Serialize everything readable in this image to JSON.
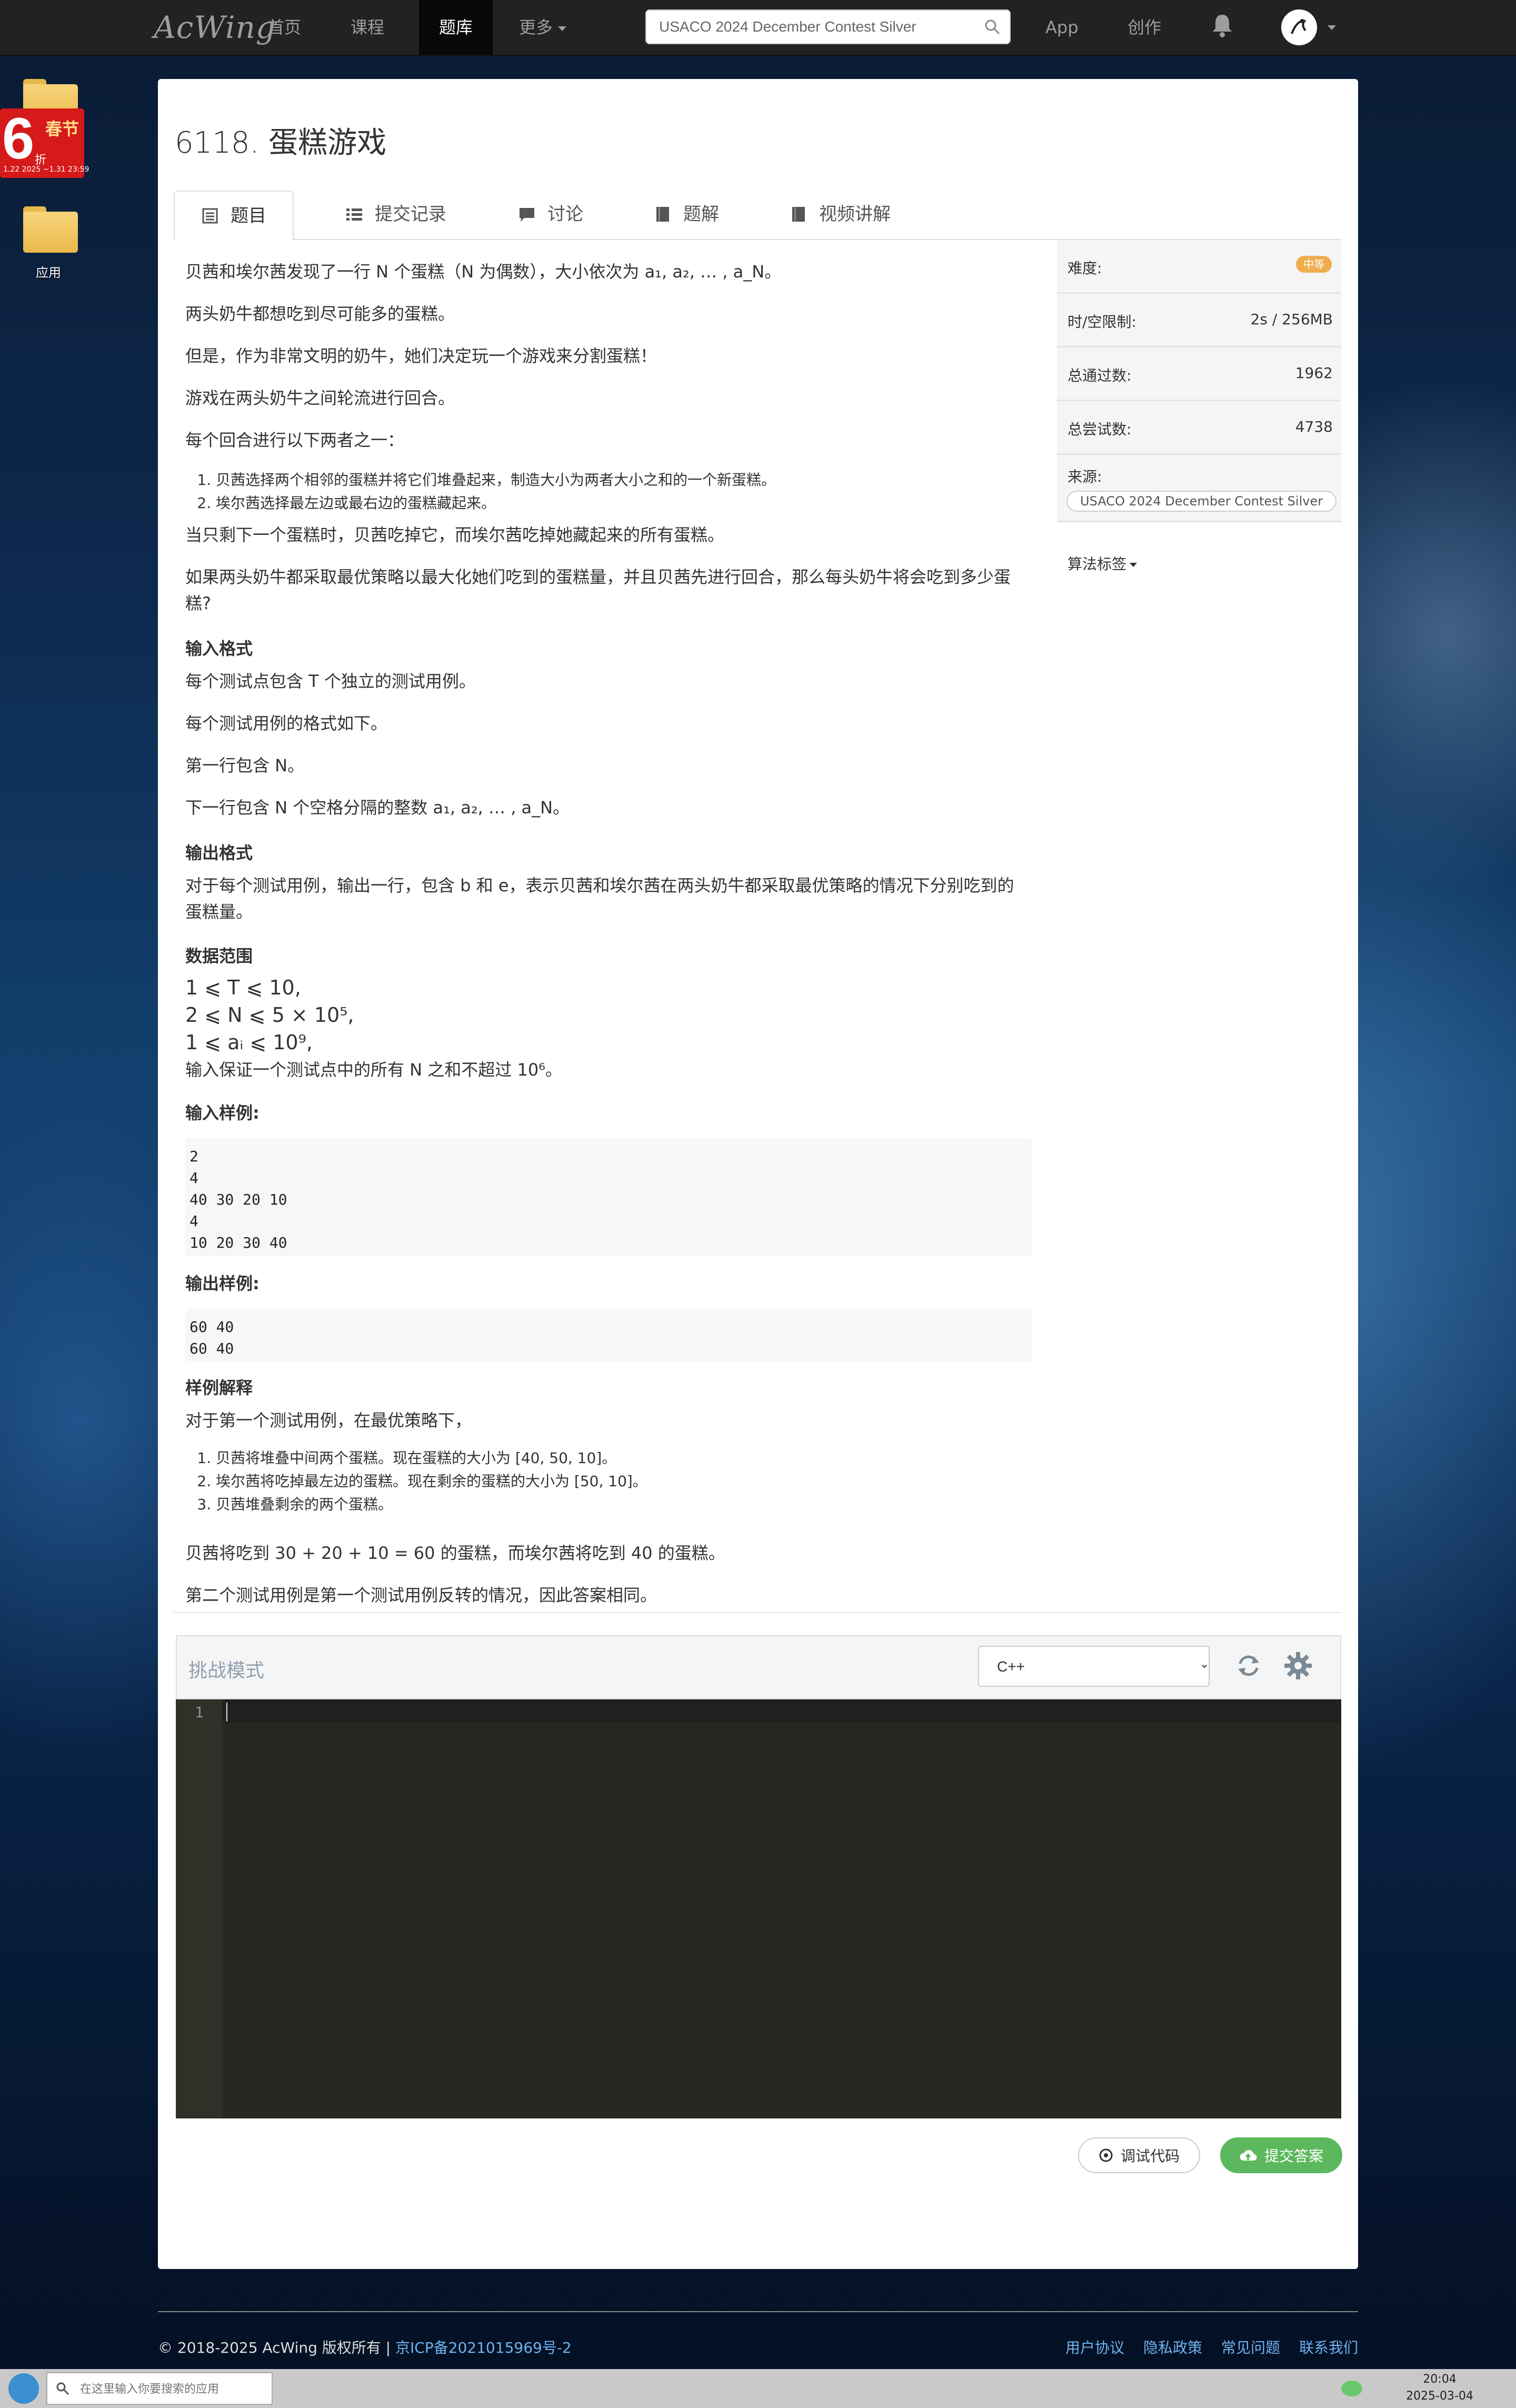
{
  "nav": {
    "logo": "AcWing",
    "items": [
      {
        "label": "首页"
      },
      {
        "label": "课程"
      },
      {
        "label": "题库"
      },
      {
        "label": "更多"
      },
      {
        "label": "App"
      },
      {
        "label": "创作"
      }
    ],
    "search_value": "USACO 2024 December Contest Silver"
  },
  "desktop": {
    "promo_number": "6",
    "promo_text": "春节",
    "promo_zhe": "折",
    "promo_dates": "1.22 2025 ~1.31 23:59",
    "app_folder_label": "应用"
  },
  "problem": {
    "title": "6118. 蛋糕游戏",
    "tabs": [
      "题目",
      "提交记录",
      "讨论",
      "题解",
      "视频讲解"
    ],
    "statement": {
      "p1": "贝茜和埃尔茜发现了一行 N 个蛋糕（N 为偶数），大小依次为 a₁, a₂, … , a_N。",
      "p2": "两头奶牛都想吃到尽可能多的蛋糕。",
      "p3": "但是，作为非常文明的奶牛，她们决定玩一个游戏来分割蛋糕！",
      "p4": "游戏在两头奶牛之间轮流进行回合。",
      "p5": "每个回合进行以下两者之一：",
      "rules": [
        "贝茜选择两个相邻的蛋糕并将它们堆叠起来，制造大小为两者大小之和的一个新蛋糕。",
        "埃尔茜选择最左边或最右边的蛋糕藏起来。"
      ],
      "p6": "当只剩下一个蛋糕时，贝茜吃掉它，而埃尔茜吃掉她藏起来的所有蛋糕。",
      "p7a": "如果两头奶牛都采取最优策略以最大化她们吃到的蛋糕量，并且贝茜先进行回合，那么每头奶牛将会吃到多少蛋",
      "p7b": "糕?",
      "input_head": "输入格式",
      "input_1": "每个测试点包含 T 个独立的测试用例。",
      "input_2": "每个测试用例的格式如下。",
      "input_3": "第一行包含 N。",
      "input_4": "下一行包含 N 个空格分隔的整数 a₁, a₂, … , a_N。",
      "output_head": "输出格式",
      "output_1a": "对于每个测试用例，输出一行，包含 b 和 e，表示贝茜和埃尔茜在两头奶牛都采取最优策略的情况下分别吃到的",
      "output_1b": "蛋糕量。",
      "range_head": "数据范围",
      "range_1": "1 ⩽ T ⩽ 10,",
      "range_2": "2 ⩽ N ⩽ 5 × 10⁵,",
      "range_3": "1 ⩽ aᵢ ⩽ 10⁹,",
      "range_4": "输入保证一个测试点中的所有 N 之和不超过 10⁶。",
      "sample_in_head": "输入样例:",
      "sample_in": [
        "2",
        "4",
        "40 30 20 10",
        "4",
        "10 20 30 40"
      ],
      "sample_out_head": "输出样例:",
      "sample_out": [
        "60 40",
        "60 40"
      ],
      "explain_head": "样例解释",
      "explain_1": "对于第一个测试用例，在最优策略下，",
      "explain_steps": [
        "贝茜将堆叠中间两个蛋糕。现在蛋糕的大小为 [40, 50, 10]。",
        "埃尔茜将吃掉最左边的蛋糕。现在剩余的蛋糕的大小为 [50, 10]。",
        "贝茜堆叠剩余的两个蛋糕。"
      ],
      "explain_2": "贝茜将吃到 30 + 20 + 10 = 60 的蛋糕，而埃尔茜将吃到 40 的蛋糕。",
      "explain_3": "第二个测试用例是第一个测试用例反转的情况，因此答案相同。"
    }
  },
  "sidebar": {
    "difficulty_label": "难度:",
    "difficulty_value": "中等",
    "limit_label": "时/空限制:",
    "limit_value": "2s / 256MB",
    "passed_label": "总通过数:",
    "passed_value": "1962",
    "tried_label": "总尝试数:",
    "tried_value": "4738",
    "source_label": "来源:",
    "source_value": "USACO 2024 December Contest Silver",
    "algo_tags_label": "算法标签"
  },
  "editor": {
    "mode_label": "挑战模式",
    "language": "C++",
    "language_options": [
      "C++"
    ],
    "line_number": "1",
    "debug_label": "调试代码",
    "submit_label": "提交答案"
  },
  "footer": {
    "copyright": "© 2018-2025 AcWing 版权所有  |  ",
    "icp": "京ICP备2021015969号-2",
    "links": [
      "用户协议",
      "隐私政策",
      "常见问题",
      "联系我们"
    ]
  },
  "taskbar": {
    "search_placeholder": "在这里输入你要搜索的应用",
    "time": "20:04",
    "date": "2025-03-04"
  },
  "colors": {
    "navbar": "#222222",
    "nav_active": "#080808",
    "difficulty_badge": "#f0ad4e",
    "submit_button": "#5cb85c",
    "editor_bg": "#272822",
    "link": "#6fb3f0"
  }
}
